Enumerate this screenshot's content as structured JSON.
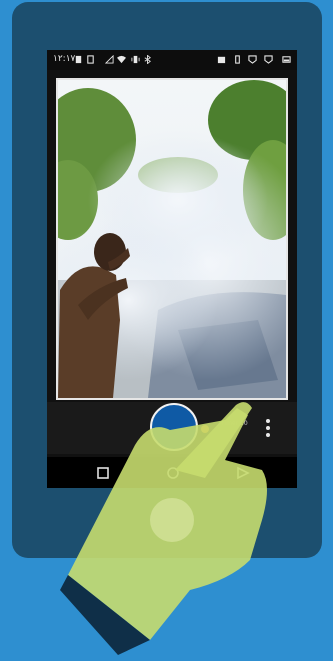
{
  "status_bar": {
    "time": "١٢:١٧",
    "left_icons": [
      "sim-card-icon",
      "clipboard-icon",
      "signal-icon",
      "wifi-icon",
      "vibrate-icon",
      "bluetooth-icon"
    ],
    "right_icons": [
      "gallery-icon",
      "phone-icon",
      "shield-icon",
      "shield-icon",
      "battery-icon"
    ]
  },
  "camera": {
    "mode_label": "Timer 10",
    "accent_color": "#ff8c1a",
    "shutter_color": "#0f5aa5"
  },
  "nav_bar": {
    "buttons": [
      "recent-apps-icon",
      "home-icon",
      "back-icon"
    ]
  },
  "colors": {
    "background": "#2e8fd0",
    "device": "#1c4f6f",
    "hand": "#c7dc6e"
  }
}
